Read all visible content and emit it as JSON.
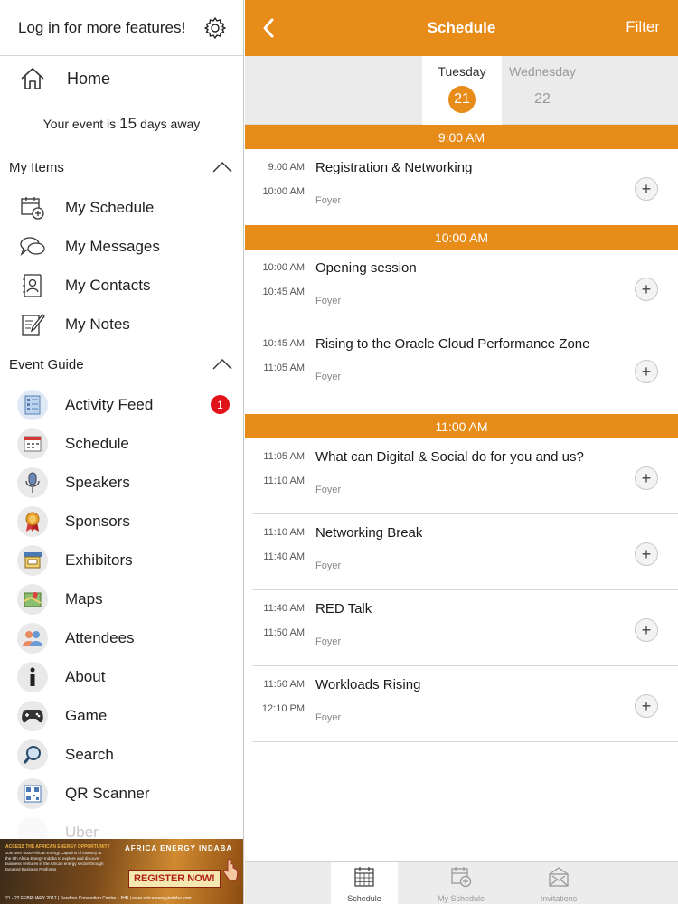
{
  "sidebar": {
    "login_text": "Log in for more features!",
    "home_label": "Home",
    "countdown_prefix": "Your event is",
    "countdown_number": "15",
    "countdown_suffix": "days away",
    "my_items_title": "My Items",
    "my_items": [
      {
        "label": "My Schedule",
        "icon": "calendar-add-icon"
      },
      {
        "label": "My Messages",
        "icon": "chat-bubbles-icon"
      },
      {
        "label": "My Contacts",
        "icon": "contact-card-icon"
      },
      {
        "label": "My Notes",
        "icon": "notepad-icon"
      }
    ],
    "event_guide_title": "Event Guide",
    "event_guide": [
      {
        "label": "Activity Feed",
        "icon": "activity-feed-icon",
        "badge": "1"
      },
      {
        "label": "Schedule",
        "icon": "schedule-icon"
      },
      {
        "label": "Speakers",
        "icon": "microphone-icon"
      },
      {
        "label": "Sponsors",
        "icon": "ribbon-icon"
      },
      {
        "label": "Exhibitors",
        "icon": "booth-icon"
      },
      {
        "label": "Maps",
        "icon": "map-pin-icon"
      },
      {
        "label": "Attendees",
        "icon": "people-icon"
      },
      {
        "label": "About",
        "icon": "info-icon"
      },
      {
        "label": "Game",
        "icon": "gamepad-icon"
      },
      {
        "label": "Search",
        "icon": "magnifier-icon"
      },
      {
        "label": "QR Scanner",
        "icon": "qr-code-icon"
      },
      {
        "label": "Uber",
        "icon": "car-icon"
      }
    ],
    "ad": {
      "headline": "ACCESS THE AFRICAN ENERGY OPPORTUNITY",
      "body": "Join over 5000 African Energy Captains of Industry at the 9th Africa Energy Indaba to explore and discover business ventures in the African energy sector through targeted Business Platforms",
      "logo": "AFRICA ENERGY INDABA",
      "button": "REGISTER NOW!",
      "footer": "21 - 22 FEBRUARY 2017 | Sandton Convention Centre - JHB | www.africaenergyindaba.com"
    }
  },
  "header": {
    "title": "Schedule",
    "filter_label": "Filter"
  },
  "days": [
    {
      "name": "Tuesday",
      "number": "21"
    },
    {
      "name": "Wednesday",
      "number": "22"
    }
  ],
  "slots": [
    {
      "label": "9:00 AM",
      "sessions": [
        {
          "start": "9:00 AM",
          "end": "10:00 AM",
          "title": "Registration & Networking",
          "location": "Foyer"
        }
      ]
    },
    {
      "label": "10:00 AM",
      "sessions": [
        {
          "start": "10:00 AM",
          "end": "10:45 AM",
          "title": "Opening session",
          "location": "Foyer"
        },
        {
          "start": "10:45 AM",
          "end": "11:05 AM",
          "title": "Rising to the Oracle Cloud Performance Zone",
          "location": "Foyer"
        }
      ]
    },
    {
      "label": "11:00 AM",
      "sessions": [
        {
          "start": "11:05 AM",
          "end": "11:10 AM",
          "title": "What can Digital & Social do for you and us?",
          "location": "Foyer"
        },
        {
          "start": "11:10 AM",
          "end": "11:40 AM",
          "title": "Networking Break",
          "location": "Foyer"
        },
        {
          "start": "11:40 AM",
          "end": "11:50 AM",
          "title": "RED Talk",
          "location": "Foyer"
        },
        {
          "start": "11:50 AM",
          "end": "12:10 PM",
          "title": "Workloads Rising",
          "location": "Foyer"
        }
      ]
    }
  ],
  "add_label": "+",
  "tabs": [
    {
      "label": "Schedule",
      "icon": "calendar-grid-icon",
      "active": true
    },
    {
      "label": "My Schedule",
      "icon": "calendar-add-icon",
      "active": false
    },
    {
      "label": "Invitations",
      "icon": "envelope-icon",
      "active": false
    }
  ],
  "colors": {
    "accent": "#e78b19",
    "badge": "#e0131a"
  }
}
